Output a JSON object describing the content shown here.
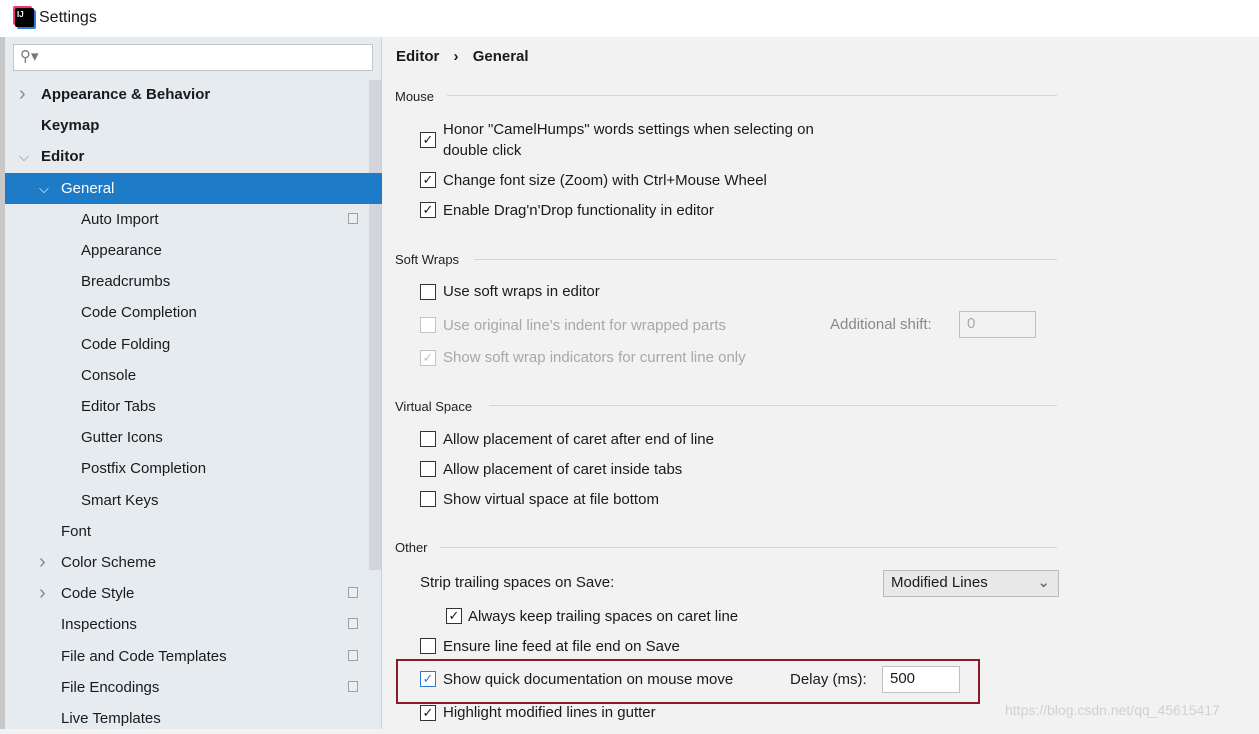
{
  "window": {
    "title": "Settings"
  },
  "sidebar": {
    "search_placeholder": "",
    "items": [
      {
        "label": "Appearance & Behavior",
        "bold": true,
        "chevron": "right"
      },
      {
        "label": "Keymap",
        "bold": true
      },
      {
        "label": "Editor",
        "bold": true,
        "chevron": "down"
      },
      {
        "label": "General",
        "chevron": "down",
        "selected": true
      },
      {
        "label": "Auto Import",
        "copy": true
      },
      {
        "label": "Appearance"
      },
      {
        "label": "Breadcrumbs"
      },
      {
        "label": "Code Completion"
      },
      {
        "label": "Code Folding"
      },
      {
        "label": "Console"
      },
      {
        "label": "Editor Tabs"
      },
      {
        "label": "Gutter Icons"
      },
      {
        "label": "Postfix Completion"
      },
      {
        "label": "Smart Keys"
      },
      {
        "label": "Font"
      },
      {
        "label": "Color Scheme",
        "chevron": "right"
      },
      {
        "label": "Code Style",
        "chevron": "right",
        "copy": true
      },
      {
        "label": "Inspections",
        "copy": true
      },
      {
        "label": "File and Code Templates",
        "copy": true
      },
      {
        "label": "File Encodings",
        "copy": true
      },
      {
        "label": "Live Templates"
      }
    ]
  },
  "breadcrumb": {
    "parent": "Editor",
    "sep": "›",
    "current": "General"
  },
  "sections": {
    "mouse": "Mouse",
    "soft_wraps": "Soft Wraps",
    "virtual_space": "Virtual Space",
    "other": "Other"
  },
  "options": {
    "camel1": "Honor \"CamelHumps\" words settings when selecting on",
    "camel2": "double click",
    "zoom": "Change font size (Zoom) with Ctrl+Mouse Wheel",
    "dnd": "Enable Drag'n'Drop functionality in editor",
    "softwraps": "Use soft wraps in editor",
    "indent": "Use original line's indent for wrapped parts",
    "additional_shift_label": "Additional shift:",
    "additional_shift_value": "0",
    "indicators": "Show soft wrap indicators for current line only",
    "caret_end": "Allow placement of caret after end of line",
    "caret_tabs": "Allow placement of caret inside tabs",
    "virtual_bottom": "Show virtual space at file bottom",
    "strip_label": "Strip trailing spaces on Save:",
    "strip_value": "Modified Lines",
    "keep_trailing": "Always keep trailing spaces on caret line",
    "line_feed": "Ensure line feed at file end on Save",
    "quick_doc": "Show quick documentation on mouse move",
    "delay_label": "Delay (ms):",
    "delay_value": "500",
    "highlight": "Highlight modified lines in gutter"
  },
  "watermark": "https://blog.csdn.net/qq_45615417",
  "colors": {
    "selection": "#1e7bc8",
    "highlight_box": "#8b1a2b"
  }
}
